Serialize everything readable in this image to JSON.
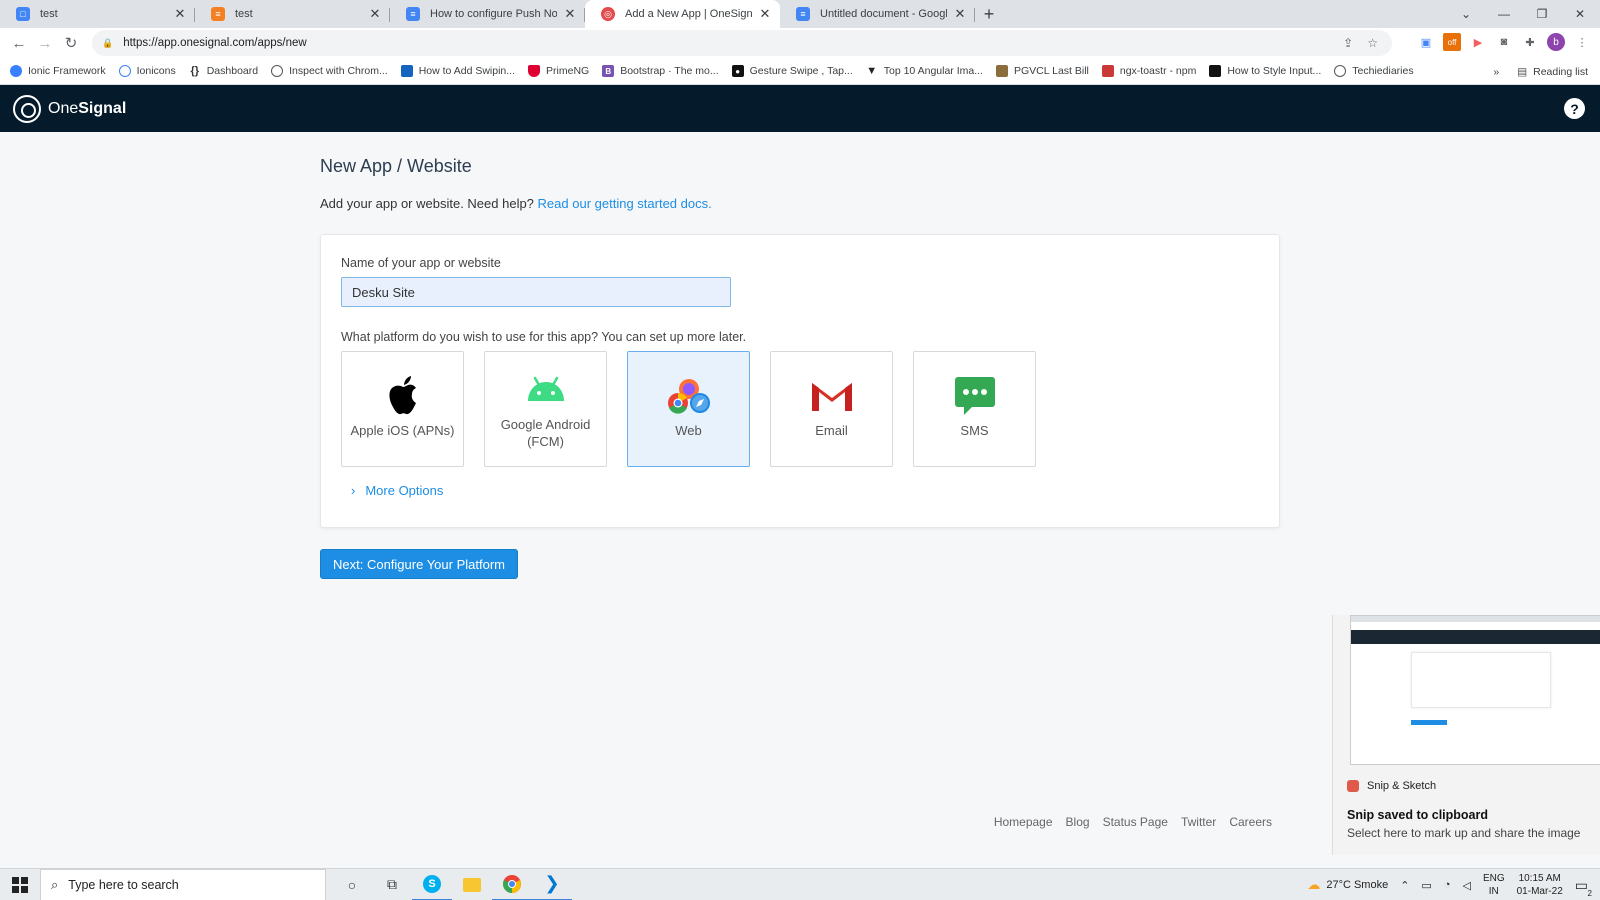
{
  "browser": {
    "tabs": [
      {
        "title": "test",
        "favicon": "doc-icon",
        "color": "#4285f4"
      },
      {
        "title": "test",
        "favicon": "stack-icon",
        "color": "#f48024"
      },
      {
        "title": "How to configure Push Notificati",
        "favicon": "docs-icon",
        "color": "#4285f4"
      },
      {
        "title": "Add a New App | OneSignal",
        "favicon": "onesignal-icon",
        "color": "#e54b4d"
      },
      {
        "title": "Untitled document - Google Doc",
        "favicon": "docs-icon",
        "color": "#4285f4"
      }
    ],
    "active_tab": 3,
    "url": "https://app.onesignal.com/apps/new",
    "bookmarks": [
      {
        "label": "Ionic Framework",
        "color": "#3880ff"
      },
      {
        "label": "Ionicons",
        "color": "#3880ff"
      },
      {
        "label": "Dashboard",
        "color": "#333333"
      },
      {
        "label": "Inspect with Chrom...",
        "color": "#555555"
      },
      {
        "label": "How to Add Swipin...",
        "color": "#1565c0"
      },
      {
        "label": "PrimeNG",
        "color": "#dd0031"
      },
      {
        "label": "Bootstrap · The mo...",
        "color": "#7952b3"
      },
      {
        "label": "Gesture Swipe , Tap...",
        "color": "#111111"
      },
      {
        "label": "Top 10 Angular Ima...",
        "color": "#222222"
      },
      {
        "label": "PGVCL Last Bill",
        "color": "#8a6d3b"
      },
      {
        "label": "ngx-toastr - npm",
        "color": "#cb3837"
      },
      {
        "label": "How to Style Input...",
        "color": "#111111"
      },
      {
        "label": "Techiediaries",
        "color": "#555555"
      }
    ],
    "bookmarks_overflow": "»",
    "reading_list": "Reading list"
  },
  "app": {
    "brand_one": "One",
    "brand_signal": "Signal",
    "help": "?",
    "page_title": "New App / Website",
    "intro_text": "Add your app or website. Need help?",
    "intro_link": "Read our getting started docs.",
    "name_label": "Name of your app or website",
    "name_value": "Desku Site",
    "platform_label": "What platform do you wish to use for this app? You can set up more later.",
    "platforms": [
      {
        "label": "Apple iOS (APNs)",
        "icon": "apple-icon",
        "selected": false
      },
      {
        "label": "Google Android (FCM)",
        "icon": "android-icon",
        "selected": false
      },
      {
        "label": "Web",
        "icon": "web-browsers-icon",
        "selected": true
      },
      {
        "label": "Email",
        "icon": "gmail-icon",
        "selected": false
      },
      {
        "label": "SMS",
        "icon": "sms-icon",
        "selected": false
      }
    ],
    "more_options": "More Options",
    "next_button": "Next: Configure Your Platform",
    "footer_links": [
      "Homepage",
      "Blog",
      "Status Page",
      "Twitter",
      "Careers"
    ],
    "accent_color": "#1d8ee3",
    "header_color": "#051b2c"
  },
  "notification": {
    "app_name": "Snip & Sketch",
    "title": "Snip saved to clipboard",
    "body": "Select here to mark up and share the image"
  },
  "taskbar": {
    "search_placeholder": "Type here to search",
    "weather": "27°C  Smoke",
    "language": "ENG",
    "region": "IN",
    "time": "10:15 AM",
    "date": "01-Mar-22",
    "notifications_count": "2"
  }
}
